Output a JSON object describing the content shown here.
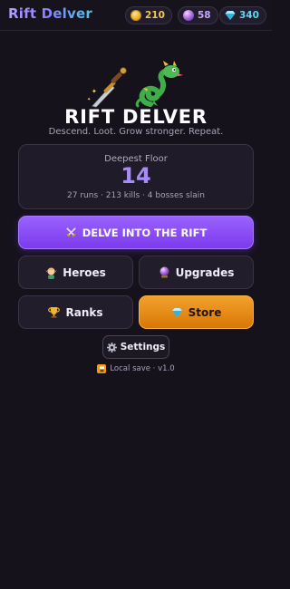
{
  "header": {
    "title": "Rift Delver",
    "currencies": [
      {
        "name": "gold",
        "value": "210",
        "color": "#f2c94c",
        "icon": "gold-coin-icon"
      },
      {
        "name": "orbs",
        "value": "58",
        "color": "#c7a6ff",
        "icon": "crystal-ball-icon"
      },
      {
        "name": "gems",
        "value": "340",
        "color": "#62d6f2",
        "icon": "gem-icon"
      }
    ]
  },
  "hero": {
    "icons": [
      "dagger-icon",
      "dragon-icon"
    ],
    "title": "RIFT DELVER",
    "tagline": "Descend. Loot. Grow stronger. Repeat."
  },
  "stats": {
    "label": "Deepest Floor",
    "value": "14",
    "summary": "27 runs · 213 kills · 4 bosses slain"
  },
  "actions": {
    "primary": {
      "label": "DELVE INTO THE RIFT",
      "icon": "crossed-swords-icon"
    },
    "heroes": {
      "label": "Heroes",
      "icon": "elf-icon"
    },
    "upgrades": {
      "label": "Upgrades",
      "icon": "crystal-ball-icon"
    },
    "ranks": {
      "label": "Ranks",
      "icon": "trophy-icon"
    },
    "store": {
      "label": "Store",
      "icon": "gem-icon"
    },
    "settings": {
      "label": "Settings",
      "icon": "gear-icon"
    }
  },
  "footer": {
    "text": "Local save · v1.0",
    "icon": "save-icon"
  },
  "colors": {
    "background": "#15121c",
    "accent": "#7c3aed",
    "accent_value": "#a78bfa",
    "store": "#d97706"
  }
}
